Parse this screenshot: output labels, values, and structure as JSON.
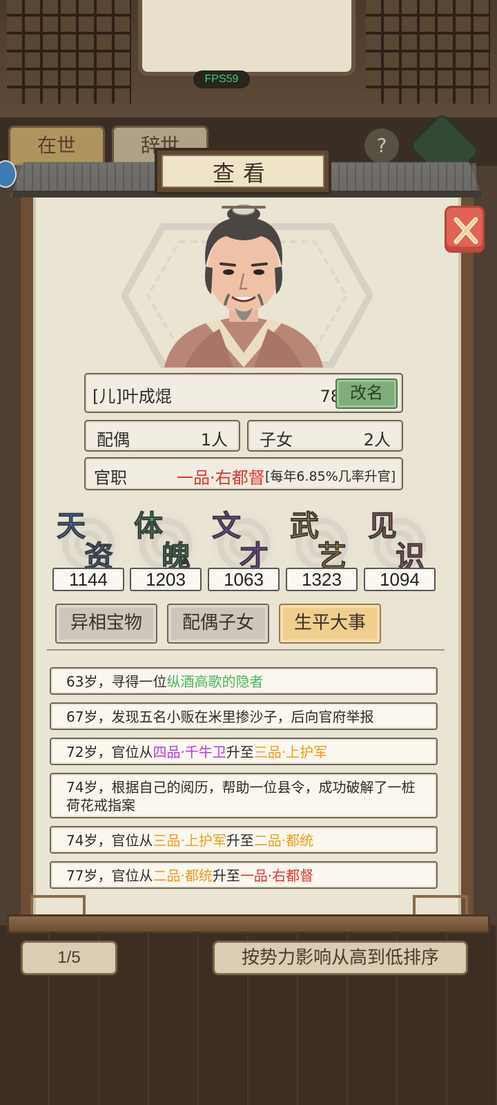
{
  "fps": "FPS59",
  "background": {
    "tabs": [
      "在世",
      "辞世"
    ],
    "help": "?",
    "pager": "1/5",
    "sort": "按势力影响从高到低排序"
  },
  "dialog": {
    "title": "查看",
    "name": "[儿]叶成焜",
    "age": "78岁",
    "rename": "改名",
    "spouse_label": "配偶",
    "spouse_value": "1人",
    "kids_label": "子女",
    "kids_value": "2人",
    "office_label": "官职",
    "office_rank": "一品·右都督",
    "office_rate": "[每年6.85%几率升官]"
  },
  "attributes": [
    {
      "c1": "天",
      "c2": "资",
      "value": "1144",
      "color": "#2e86e6"
    },
    {
      "c1": "体",
      "c2": "魄",
      "value": "1203",
      "color": "#2fb865"
    },
    {
      "c1": "文",
      "c2": "才",
      "value": "1063",
      "color": "#9b44d6"
    },
    {
      "c1": "武",
      "c2": "艺",
      "value": "1323",
      "color": "#f0a21e"
    },
    {
      "c1": "见",
      "c2": "识",
      "value": "1094",
      "color": "#e25a6a"
    }
  ],
  "tabs": [
    {
      "label": "异相宝物",
      "active": false
    },
    {
      "label": "配偶子女",
      "active": false
    },
    {
      "label": "生平大事",
      "active": true
    }
  ],
  "events": [
    {
      "parts": [
        {
          "t": "63岁，寻得一位",
          "c": ""
        },
        {
          "t": "纵酒高歌的隐者",
          "c": "green"
        }
      ]
    },
    {
      "parts": [
        {
          "t": "67岁，发现五名小贩在米里掺沙子，后向官府举报",
          "c": ""
        }
      ]
    },
    {
      "parts": [
        {
          "t": "72岁，官位从",
          "c": ""
        },
        {
          "t": "四品·千牛卫",
          "c": "purple"
        },
        {
          "t": "升至",
          "c": ""
        },
        {
          "t": "三品·上护军",
          "c": "orange"
        }
      ]
    },
    {
      "parts": [
        {
          "t": "74岁，根据自己的阅历，帮助一位县令，成功破解了一桩荷花戒指案",
          "c": ""
        }
      ]
    },
    {
      "parts": [
        {
          "t": "74岁，官位从",
          "c": ""
        },
        {
          "t": "三品·上护军",
          "c": "orange"
        },
        {
          "t": "升至",
          "c": ""
        },
        {
          "t": "二品·都统",
          "c": "orange"
        }
      ]
    },
    {
      "parts": [
        {
          "t": "77岁，官位从",
          "c": ""
        },
        {
          "t": "二品·都统",
          "c": "orange"
        },
        {
          "t": "升至",
          "c": ""
        },
        {
          "t": "一品·右都督",
          "c": "red"
        }
      ]
    }
  ]
}
